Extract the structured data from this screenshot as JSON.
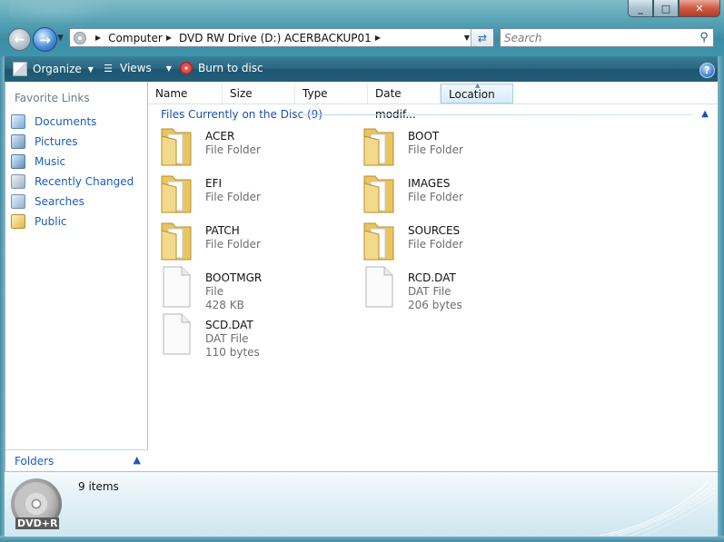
{
  "window": {
    "controls": [
      "_",
      "□",
      "✕"
    ]
  },
  "address": {
    "crumbs": [
      "Computer",
      "DVD RW Drive (D:) ACERBACKUP01"
    ]
  },
  "search": {
    "placeholder": "Search"
  },
  "toolbar": {
    "organize_label": "Organize",
    "views_label": "Views",
    "burn_label": "Burn to disc",
    "help_label": "?"
  },
  "sidebar": {
    "favorites_title": "Favorite Links",
    "links": [
      {
        "label": "Documents",
        "icon": "documents-icon"
      },
      {
        "label": "Pictures",
        "icon": "pictures-icon"
      },
      {
        "label": "Music",
        "icon": "music-icon"
      },
      {
        "label": "Recently Changed",
        "icon": "recently-changed-icon"
      },
      {
        "label": "Searches",
        "icon": "searches-icon"
      },
      {
        "label": "Public",
        "icon": "public-icon"
      }
    ],
    "folders_label": "Folders"
  },
  "columns": [
    "Name",
    "Size",
    "Type",
    "Date modif...",
    "Location"
  ],
  "group": {
    "title": "Files Currently on the Disc (9)"
  },
  "files": [
    {
      "name": "ACER",
      "type": "File Folder",
      "size": "",
      "kind": "folder"
    },
    {
      "name": "BOOT",
      "type": "File Folder",
      "size": "",
      "kind": "folder"
    },
    {
      "name": "EFI",
      "type": "File Folder",
      "size": "",
      "kind": "folder"
    },
    {
      "name": "IMAGES",
      "type": "File Folder",
      "size": "",
      "kind": "folder"
    },
    {
      "name": "PATCH",
      "type": "File Folder",
      "size": "",
      "kind": "folder"
    },
    {
      "name": "SOURCES",
      "type": "File Folder",
      "size": "",
      "kind": "folder"
    },
    {
      "name": "BOOTMGR",
      "type": "File",
      "size": "428 KB",
      "kind": "file"
    },
    {
      "name": "RCD.DAT",
      "type": "DAT File",
      "size": "206 bytes",
      "kind": "file"
    },
    {
      "name": "SCD.DAT",
      "type": "DAT File",
      "size": "110 bytes",
      "kind": "file"
    }
  ],
  "details": {
    "item_count": "9 items",
    "disc_label": "DVD+R"
  },
  "colors": {
    "link": "#1d5ac0",
    "chrome": "#3b8ea6",
    "command_bar": "#235d78",
    "muted_text": "#6d6d6d"
  }
}
